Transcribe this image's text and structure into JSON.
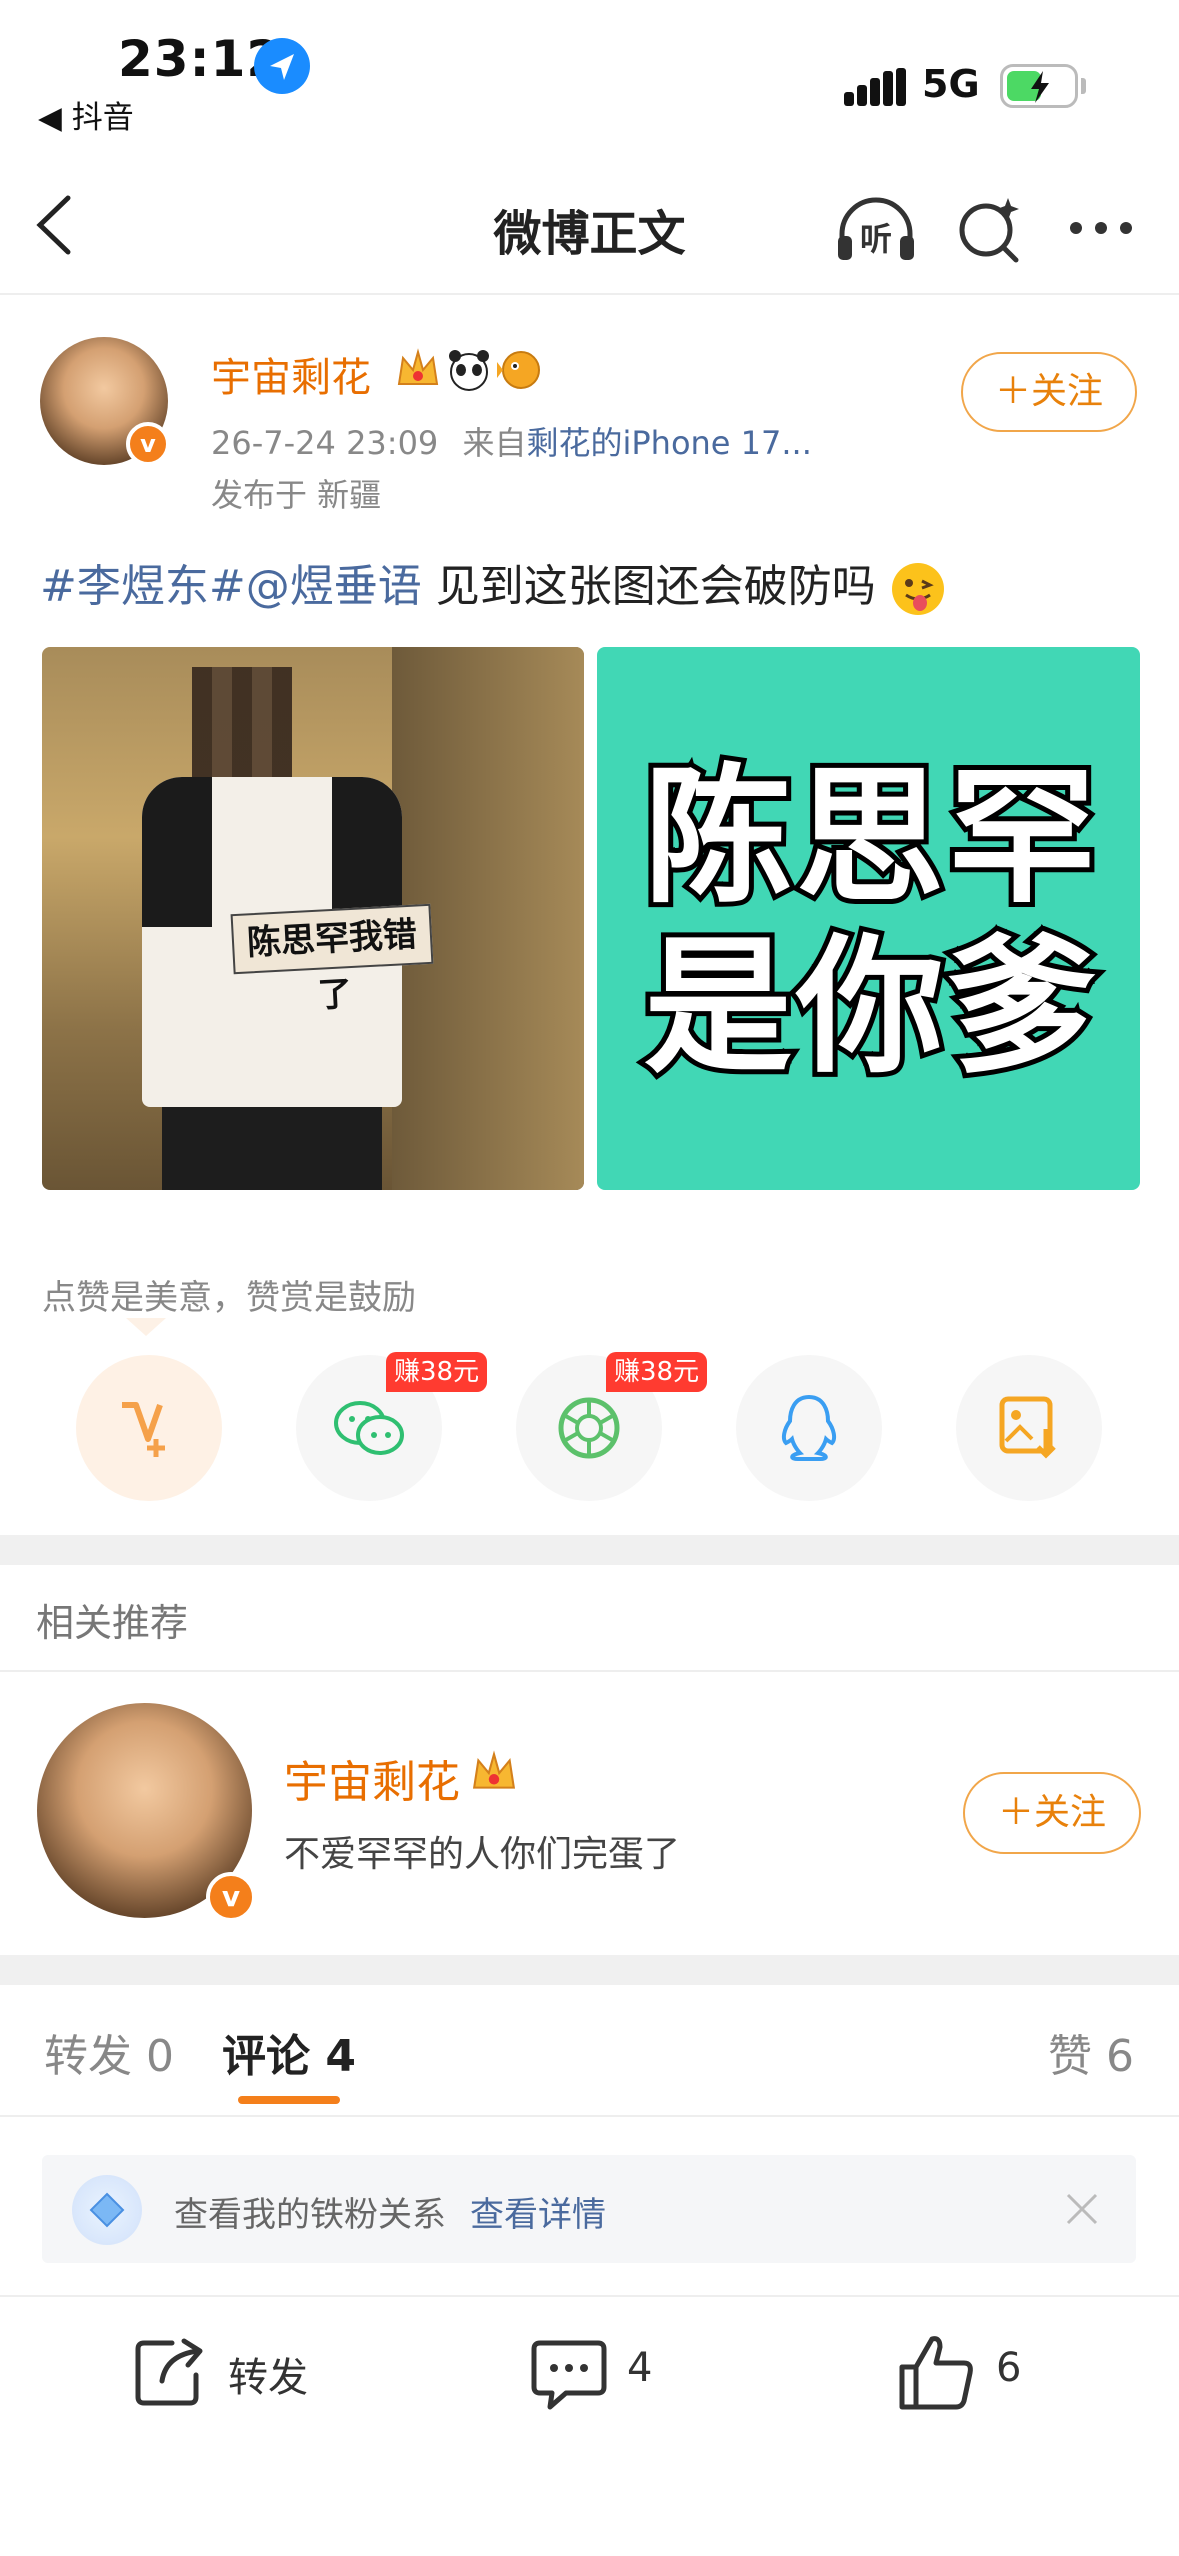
{
  "status_bar": {
    "time": "23:12",
    "back_app": "◀ 抖音",
    "network": "5G"
  },
  "nav": {
    "title": "微博正文",
    "listen_label": "听"
  },
  "post": {
    "author": "宇宙剩花",
    "timestamp": "26-7-24 23:09",
    "source_prefix": "来自",
    "source": "剩花的iPhone 17...",
    "location": "发布于 新疆",
    "follow_label": "＋关注",
    "hashtag": "#李煜东#@煜垂语",
    "text": " 见到这张图还会破防吗",
    "image1_sign_text": "陈思罕我错了",
    "image2_text_line1": "陈思罕",
    "image2_text_line2": "是你爹"
  },
  "reward": {
    "prompt": "点赞是美意，赞赏是鼓励",
    "earn_badges": [
      "赚38元",
      "赚38元"
    ]
  },
  "related": {
    "title": "相关推荐",
    "name": "宇宙剩花",
    "bio": "不爱罕罕的人你们完蛋了",
    "follow_label": "＋关注"
  },
  "tabs": {
    "repost": "转发 0",
    "comments": "评论 4",
    "likes": "赞 6"
  },
  "fan_bar": {
    "text": "查看我的铁粉关系",
    "link": "查看详情"
  },
  "bottom_bar": {
    "repost_label": "转发",
    "comment_count": "4",
    "like_count": "6"
  },
  "colors": {
    "accent": "#e86e00",
    "link": "#4a6a9e",
    "tab_indicator": "#f47f1b"
  }
}
